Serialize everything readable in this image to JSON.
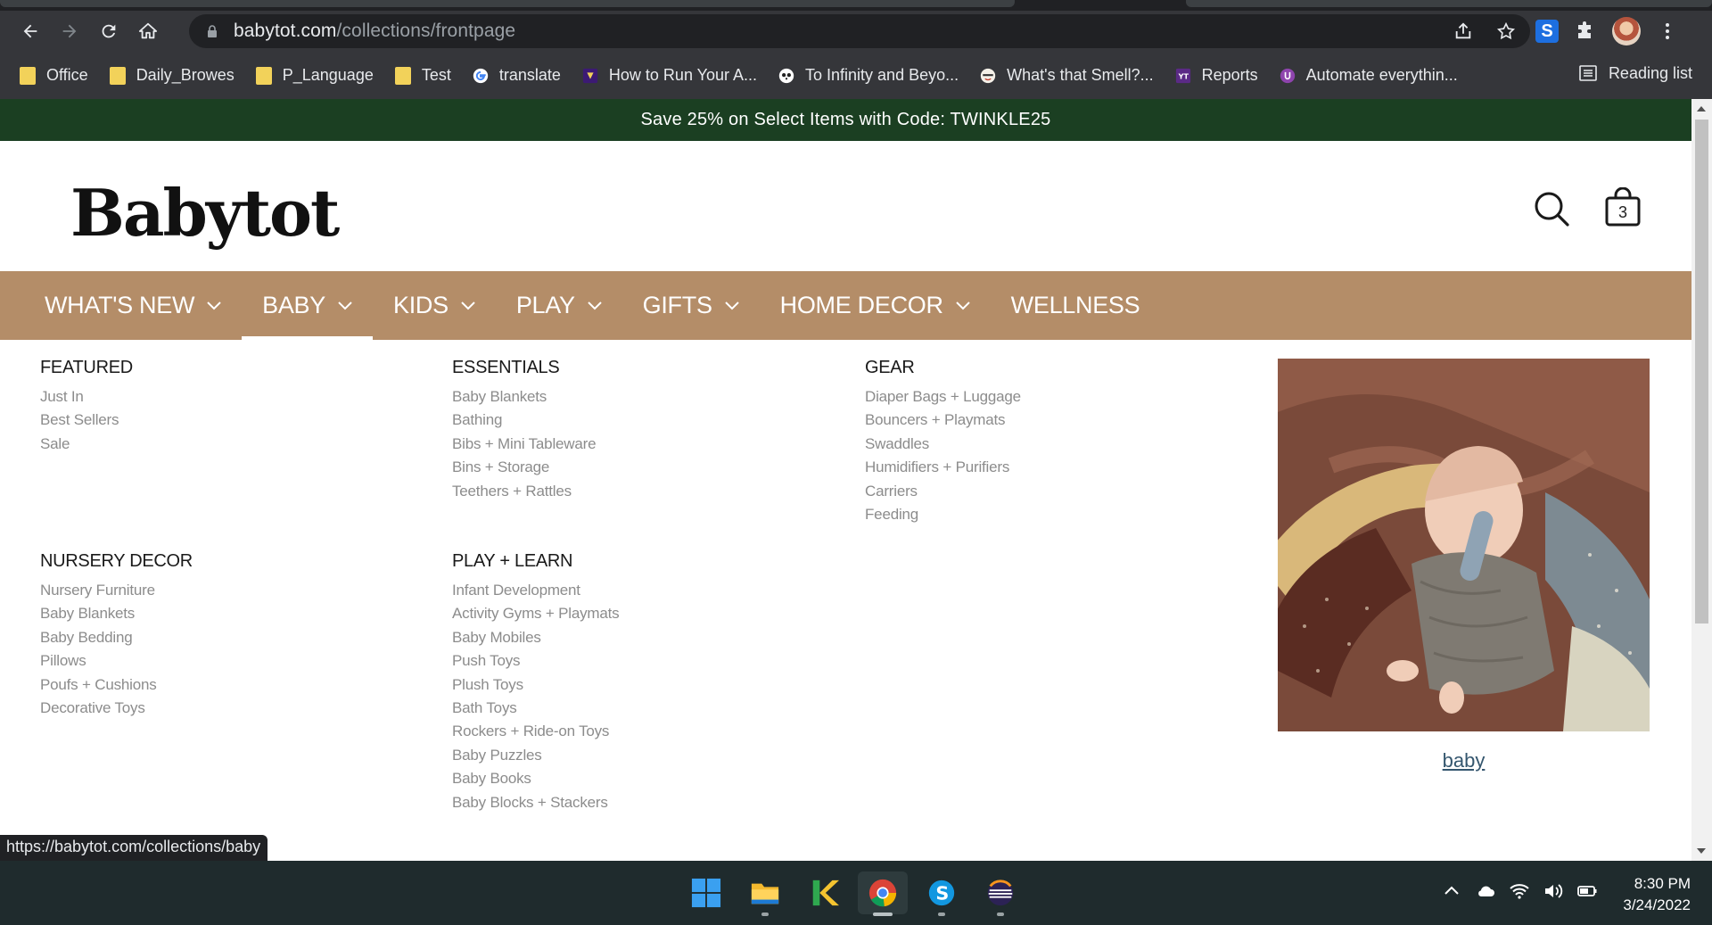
{
  "browser": {
    "url_host": "babytot.com",
    "url_path": "/collections/frontpage",
    "bookmarks": [
      {
        "label": "Office",
        "icon": "folder-icon"
      },
      {
        "label": "Daily_Browes",
        "icon": "folder-icon"
      },
      {
        "label": "P_Language",
        "icon": "folder-icon"
      },
      {
        "label": "Test",
        "icon": "folder-icon"
      },
      {
        "label": "translate",
        "icon": "google-icon"
      },
      {
        "label": "How to Run Your A...",
        "icon": "site-icon"
      },
      {
        "label": "To Infinity and Beyo...",
        "icon": "panda-icon"
      },
      {
        "label": "What's that Smell?...",
        "icon": "face-icon"
      },
      {
        "label": "Reports",
        "icon": "yt-icon"
      },
      {
        "label": "Automate everythin...",
        "icon": "purple-icon"
      }
    ],
    "reading_list": "Reading list",
    "status_url": "https://babytot.com/collections/baby"
  },
  "site": {
    "promo": "Save 25% on Select Items with Code: TWINKLE25",
    "logo": "Babytot",
    "cart_count": "3",
    "nav": [
      {
        "label": "WHAT'S NEW",
        "has_menu": true
      },
      {
        "label": "BABY",
        "has_menu": true
      },
      {
        "label": "KIDS",
        "has_menu": true
      },
      {
        "label": "PLAY",
        "has_menu": true
      },
      {
        "label": "GIFTS",
        "has_menu": true
      },
      {
        "label": "HOME DECOR",
        "has_menu": true
      },
      {
        "label": "WELLNESS",
        "has_menu": false
      }
    ],
    "mega": {
      "featured": {
        "title": "FEATURED",
        "items": [
          "Just In",
          "Best Sellers",
          "Sale"
        ]
      },
      "essentials": {
        "title": "ESSENTIALS",
        "items": [
          "Baby Blankets",
          "Bathing",
          "Bibs + Mini Tableware",
          "Bins + Storage",
          "Teethers + Rattles"
        ]
      },
      "gear": {
        "title": "GEAR",
        "items": [
          "Diaper Bags + Luggage",
          "Bouncers + Playmats",
          "Swaddles",
          "Humidifiers + Purifiers",
          "Carriers",
          "Feeding"
        ]
      },
      "nursery": {
        "title": "NURSERY DECOR",
        "items": [
          "Nursery Furniture",
          "Baby Blankets",
          "Baby Bedding",
          "Pillows",
          "Poufs + Cushions",
          "Decorative Toys"
        ]
      },
      "playlearn": {
        "title": "PLAY + LEARN",
        "items": [
          "Infant Development",
          "Activity Gyms + Playmats",
          "Baby Mobiles",
          "Push Toys",
          "Plush Toys",
          "Bath Toys",
          "Rockers + Ride-on Toys",
          "Baby Puzzles",
          "Baby Books",
          "Baby Blocks + Stackers"
        ]
      },
      "promo_link": "baby"
    }
  },
  "taskbar": {
    "time": "8:30 PM",
    "date": "3/24/2022"
  },
  "colors": {
    "promo_bg": "#1b3f22",
    "nav_bg": "#b48d68",
    "link_gray": "#8c8c8c"
  }
}
